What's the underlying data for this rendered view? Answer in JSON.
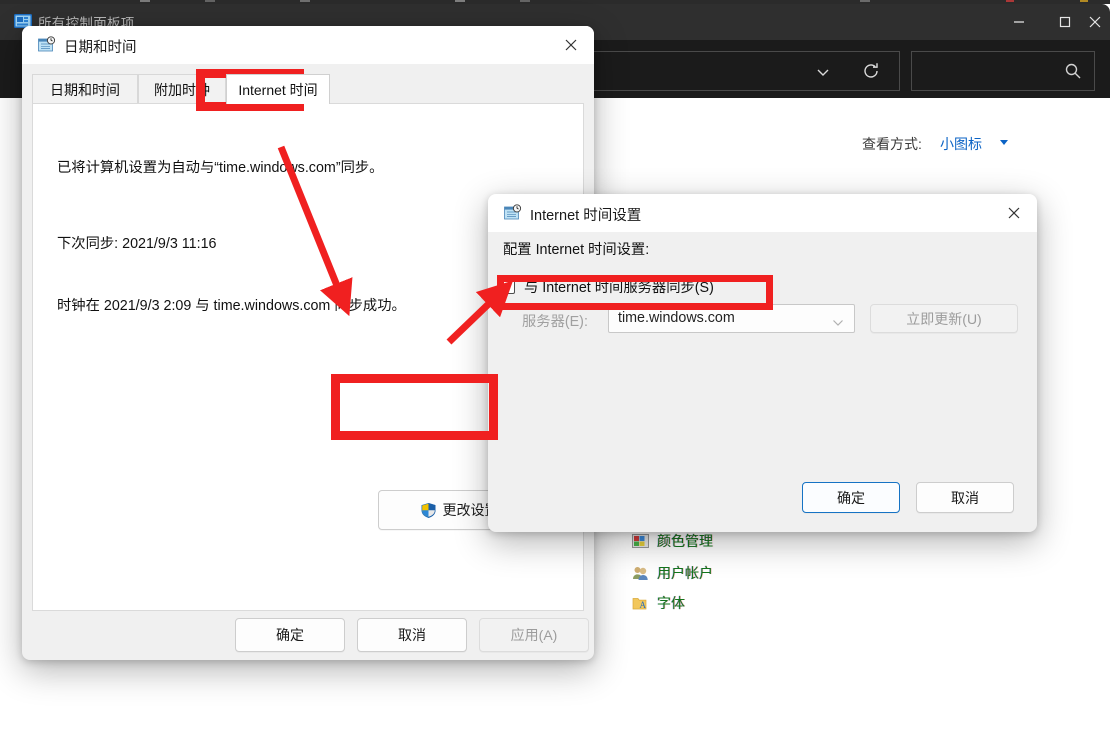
{
  "control_panel": {
    "title": "所有控制面板项",
    "title_icon": "control-panel-icon",
    "window_buttons": {
      "minimize": "–",
      "maximize": "□",
      "close": "✕"
    },
    "address_bar": {
      "value": "",
      "chevron_icon": "chevron-down-icon",
      "refresh_icon": "refresh-icon"
    },
    "search": {
      "value": "",
      "placeholder": "",
      "icon": "search-icon"
    },
    "view_by": {
      "label": "查看方式:",
      "value": "小图标",
      "caret_icon": "caret-down-icon"
    },
    "items": [
      {
        "label": "颜色管理",
        "icon": "color-management-icon"
      },
      {
        "label": "用户帐户",
        "icon": "user-accounts-icon"
      },
      {
        "label": "字体",
        "icon": "fonts-icon"
      }
    ]
  },
  "date_time_dialog": {
    "title": "日期和时间",
    "title_icon": "date-time-icon",
    "close_icon": "close-icon",
    "tabs": [
      {
        "label": "日期和时间",
        "active": false
      },
      {
        "label": "附加时钟",
        "active": false
      },
      {
        "label": "Internet 时间",
        "active": true
      }
    ],
    "body": {
      "line1": "已将计算机设置为自动与“time.windows.com”同步。",
      "line2": "下次同步: 2021/9/3 11:16",
      "line3": "时钟在 2021/9/3 2:09 与 time.windows.com 同步成功。"
    },
    "change_settings_button": {
      "label": "更改设置",
      "icon": "uac-shield-icon"
    },
    "footer": {
      "ok": "确定",
      "cancel": "取消",
      "apply": "应用(A)",
      "apply_disabled": true
    }
  },
  "internet_time_dialog": {
    "title": "Internet 时间设置",
    "title_icon": "date-time-icon",
    "close_icon": "close-icon",
    "heading": "配置 Internet 时间设置:",
    "sync_checkbox": {
      "label": "与 Internet 时间服务器同步(S)",
      "checked": false
    },
    "server_label": "服务器(E):",
    "server_value": "time.windows.com",
    "server_disabled": true,
    "update_now_button": {
      "label": "立即更新(U)",
      "disabled": true
    },
    "footer": {
      "ok": "确定",
      "cancel": "取消"
    }
  },
  "annotations": {
    "accent_color": "#f02020",
    "boxes": [
      {
        "name": "highlight-internet-time-tab"
      },
      {
        "name": "highlight-change-settings-button"
      },
      {
        "name": "highlight-sync-checkbox"
      }
    ],
    "arrows": [
      {
        "name": "arrow-tab-to-change-settings"
      },
      {
        "name": "arrow-to-sync-checkbox"
      }
    ]
  }
}
